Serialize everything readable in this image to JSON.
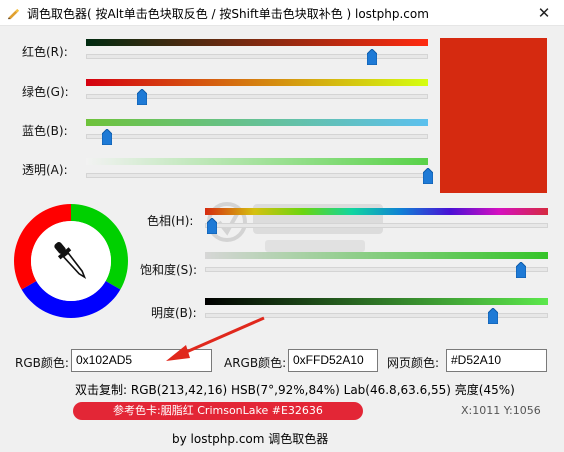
{
  "window": {
    "title": "调色取色器( 按Alt单击色块取反色 / 按Shift单击色块取补色 ) lostphp.com",
    "close_icon": "close-icon"
  },
  "channels": {
    "red": {
      "label": "红色(R):",
      "value": 213,
      "max": 255
    },
    "green": {
      "label": "绿色(G):",
      "value": 42,
      "max": 255
    },
    "blue": {
      "label": "蓝色(B):",
      "value": 16,
      "max": 255
    },
    "alpha": {
      "label": "透明(A):",
      "value": 255,
      "max": 255
    }
  },
  "hsb": {
    "hue": {
      "label": "色相(H):",
      "value": 7,
      "max": 360
    },
    "saturation": {
      "label": "饱和度(S):",
      "value": 92,
      "max": 100
    },
    "brightness": {
      "label": "明度(B):",
      "value": 84,
      "max": 100
    }
  },
  "preview": {
    "color": "#D52A10"
  },
  "wheel": {
    "colors": [
      "#ff0000",
      "#00d000",
      "#0000ff"
    ],
    "picker_icon": "eyedropper-icon"
  },
  "fields": {
    "rgb": {
      "label": "RGB颜色:",
      "value": "0x102AD5"
    },
    "argb": {
      "label": "ARGB颜色:",
      "value": "0xFFD52A10"
    },
    "web": {
      "label": "网页颜色:",
      "value": "#D52A10"
    }
  },
  "info": {
    "line": "双击复制: RGB(213,42,16) HSB(7°,92%,84%) Lab(46.8,63.6,55) 亮度(45%)"
  },
  "reference": {
    "text": "参考色卡:胭脂红  CrimsonLake  #E32636",
    "color": "#E32636"
  },
  "coords": "X:1011 Y:1056",
  "footer": "by lostphp.com 调色取色器",
  "watermark": {
    "name": "安下载",
    "domain": "anxz.com"
  },
  "accent": "#1e7ad6"
}
